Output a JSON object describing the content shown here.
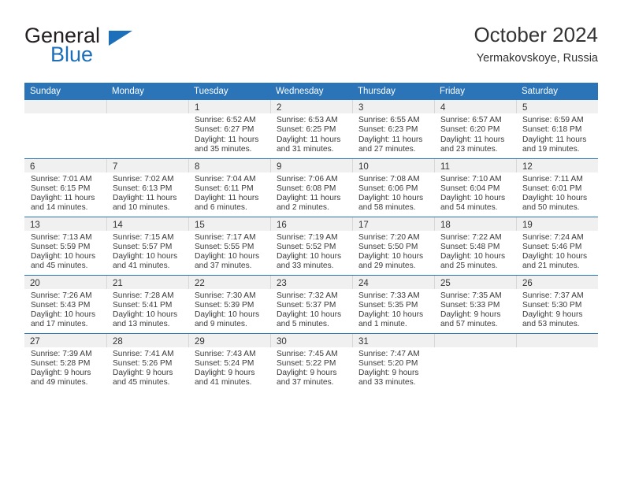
{
  "brand": {
    "name_part1": "General",
    "name_part2": "Blue",
    "logo_icon": "blue-triangle-icon"
  },
  "header": {
    "title": "October 2024",
    "subtitle": "Yermakovskoye, Russia"
  },
  "colors": {
    "header_blue": "#2b74b8",
    "brand_blue": "#1c6fb8",
    "daynum_band": "#f0f0f0",
    "text": "#333333"
  },
  "weekdays": [
    "Sunday",
    "Monday",
    "Tuesday",
    "Wednesday",
    "Thursday",
    "Friday",
    "Saturday"
  ],
  "labels": {
    "sunrise_prefix": "Sunrise:",
    "sunset_prefix": "Sunset:",
    "daylight_prefix": "Daylight:"
  },
  "weeks": [
    [
      {
        "empty": true
      },
      {
        "empty": true
      },
      {
        "day": "1",
        "sunrise": "Sunrise: 6:52 AM",
        "sunset": "Sunset: 6:27 PM",
        "daylight": "Daylight: 11 hours and 35 minutes."
      },
      {
        "day": "2",
        "sunrise": "Sunrise: 6:53 AM",
        "sunset": "Sunset: 6:25 PM",
        "daylight": "Daylight: 11 hours and 31 minutes."
      },
      {
        "day": "3",
        "sunrise": "Sunrise: 6:55 AM",
        "sunset": "Sunset: 6:23 PM",
        "daylight": "Daylight: 11 hours and 27 minutes."
      },
      {
        "day": "4",
        "sunrise": "Sunrise: 6:57 AM",
        "sunset": "Sunset: 6:20 PM",
        "daylight": "Daylight: 11 hours and 23 minutes."
      },
      {
        "day": "5",
        "sunrise": "Sunrise: 6:59 AM",
        "sunset": "Sunset: 6:18 PM",
        "daylight": "Daylight: 11 hours and 19 minutes."
      }
    ],
    [
      {
        "day": "6",
        "sunrise": "Sunrise: 7:01 AM",
        "sunset": "Sunset: 6:15 PM",
        "daylight": "Daylight: 11 hours and 14 minutes."
      },
      {
        "day": "7",
        "sunrise": "Sunrise: 7:02 AM",
        "sunset": "Sunset: 6:13 PM",
        "daylight": "Daylight: 11 hours and 10 minutes."
      },
      {
        "day": "8",
        "sunrise": "Sunrise: 7:04 AM",
        "sunset": "Sunset: 6:11 PM",
        "daylight": "Daylight: 11 hours and 6 minutes."
      },
      {
        "day": "9",
        "sunrise": "Sunrise: 7:06 AM",
        "sunset": "Sunset: 6:08 PM",
        "daylight": "Daylight: 11 hours and 2 minutes."
      },
      {
        "day": "10",
        "sunrise": "Sunrise: 7:08 AM",
        "sunset": "Sunset: 6:06 PM",
        "daylight": "Daylight: 10 hours and 58 minutes."
      },
      {
        "day": "11",
        "sunrise": "Sunrise: 7:10 AM",
        "sunset": "Sunset: 6:04 PM",
        "daylight": "Daylight: 10 hours and 54 minutes."
      },
      {
        "day": "12",
        "sunrise": "Sunrise: 7:11 AM",
        "sunset": "Sunset: 6:01 PM",
        "daylight": "Daylight: 10 hours and 50 minutes."
      }
    ],
    [
      {
        "day": "13",
        "sunrise": "Sunrise: 7:13 AM",
        "sunset": "Sunset: 5:59 PM",
        "daylight": "Daylight: 10 hours and 45 minutes."
      },
      {
        "day": "14",
        "sunrise": "Sunrise: 7:15 AM",
        "sunset": "Sunset: 5:57 PM",
        "daylight": "Daylight: 10 hours and 41 minutes."
      },
      {
        "day": "15",
        "sunrise": "Sunrise: 7:17 AM",
        "sunset": "Sunset: 5:55 PM",
        "daylight": "Daylight: 10 hours and 37 minutes."
      },
      {
        "day": "16",
        "sunrise": "Sunrise: 7:19 AM",
        "sunset": "Sunset: 5:52 PM",
        "daylight": "Daylight: 10 hours and 33 minutes."
      },
      {
        "day": "17",
        "sunrise": "Sunrise: 7:20 AM",
        "sunset": "Sunset: 5:50 PM",
        "daylight": "Daylight: 10 hours and 29 minutes."
      },
      {
        "day": "18",
        "sunrise": "Sunrise: 7:22 AM",
        "sunset": "Sunset: 5:48 PM",
        "daylight": "Daylight: 10 hours and 25 minutes."
      },
      {
        "day": "19",
        "sunrise": "Sunrise: 7:24 AM",
        "sunset": "Sunset: 5:46 PM",
        "daylight": "Daylight: 10 hours and 21 minutes."
      }
    ],
    [
      {
        "day": "20",
        "sunrise": "Sunrise: 7:26 AM",
        "sunset": "Sunset: 5:43 PM",
        "daylight": "Daylight: 10 hours and 17 minutes."
      },
      {
        "day": "21",
        "sunrise": "Sunrise: 7:28 AM",
        "sunset": "Sunset: 5:41 PM",
        "daylight": "Daylight: 10 hours and 13 minutes."
      },
      {
        "day": "22",
        "sunrise": "Sunrise: 7:30 AM",
        "sunset": "Sunset: 5:39 PM",
        "daylight": "Daylight: 10 hours and 9 minutes."
      },
      {
        "day": "23",
        "sunrise": "Sunrise: 7:32 AM",
        "sunset": "Sunset: 5:37 PM",
        "daylight": "Daylight: 10 hours and 5 minutes."
      },
      {
        "day": "24",
        "sunrise": "Sunrise: 7:33 AM",
        "sunset": "Sunset: 5:35 PM",
        "daylight": "Daylight: 10 hours and 1 minute."
      },
      {
        "day": "25",
        "sunrise": "Sunrise: 7:35 AM",
        "sunset": "Sunset: 5:33 PM",
        "daylight": "Daylight: 9 hours and 57 minutes."
      },
      {
        "day": "26",
        "sunrise": "Sunrise: 7:37 AM",
        "sunset": "Sunset: 5:30 PM",
        "daylight": "Daylight: 9 hours and 53 minutes."
      }
    ],
    [
      {
        "day": "27",
        "sunrise": "Sunrise: 7:39 AM",
        "sunset": "Sunset: 5:28 PM",
        "daylight": "Daylight: 9 hours and 49 minutes."
      },
      {
        "day": "28",
        "sunrise": "Sunrise: 7:41 AM",
        "sunset": "Sunset: 5:26 PM",
        "daylight": "Daylight: 9 hours and 45 minutes."
      },
      {
        "day": "29",
        "sunrise": "Sunrise: 7:43 AM",
        "sunset": "Sunset: 5:24 PM",
        "daylight": "Daylight: 9 hours and 41 minutes."
      },
      {
        "day": "30",
        "sunrise": "Sunrise: 7:45 AM",
        "sunset": "Sunset: 5:22 PM",
        "daylight": "Daylight: 9 hours and 37 minutes."
      },
      {
        "day": "31",
        "sunrise": "Sunrise: 7:47 AM",
        "sunset": "Sunset: 5:20 PM",
        "daylight": "Daylight: 9 hours and 33 minutes."
      },
      {
        "empty": true
      },
      {
        "empty": true
      }
    ]
  ]
}
